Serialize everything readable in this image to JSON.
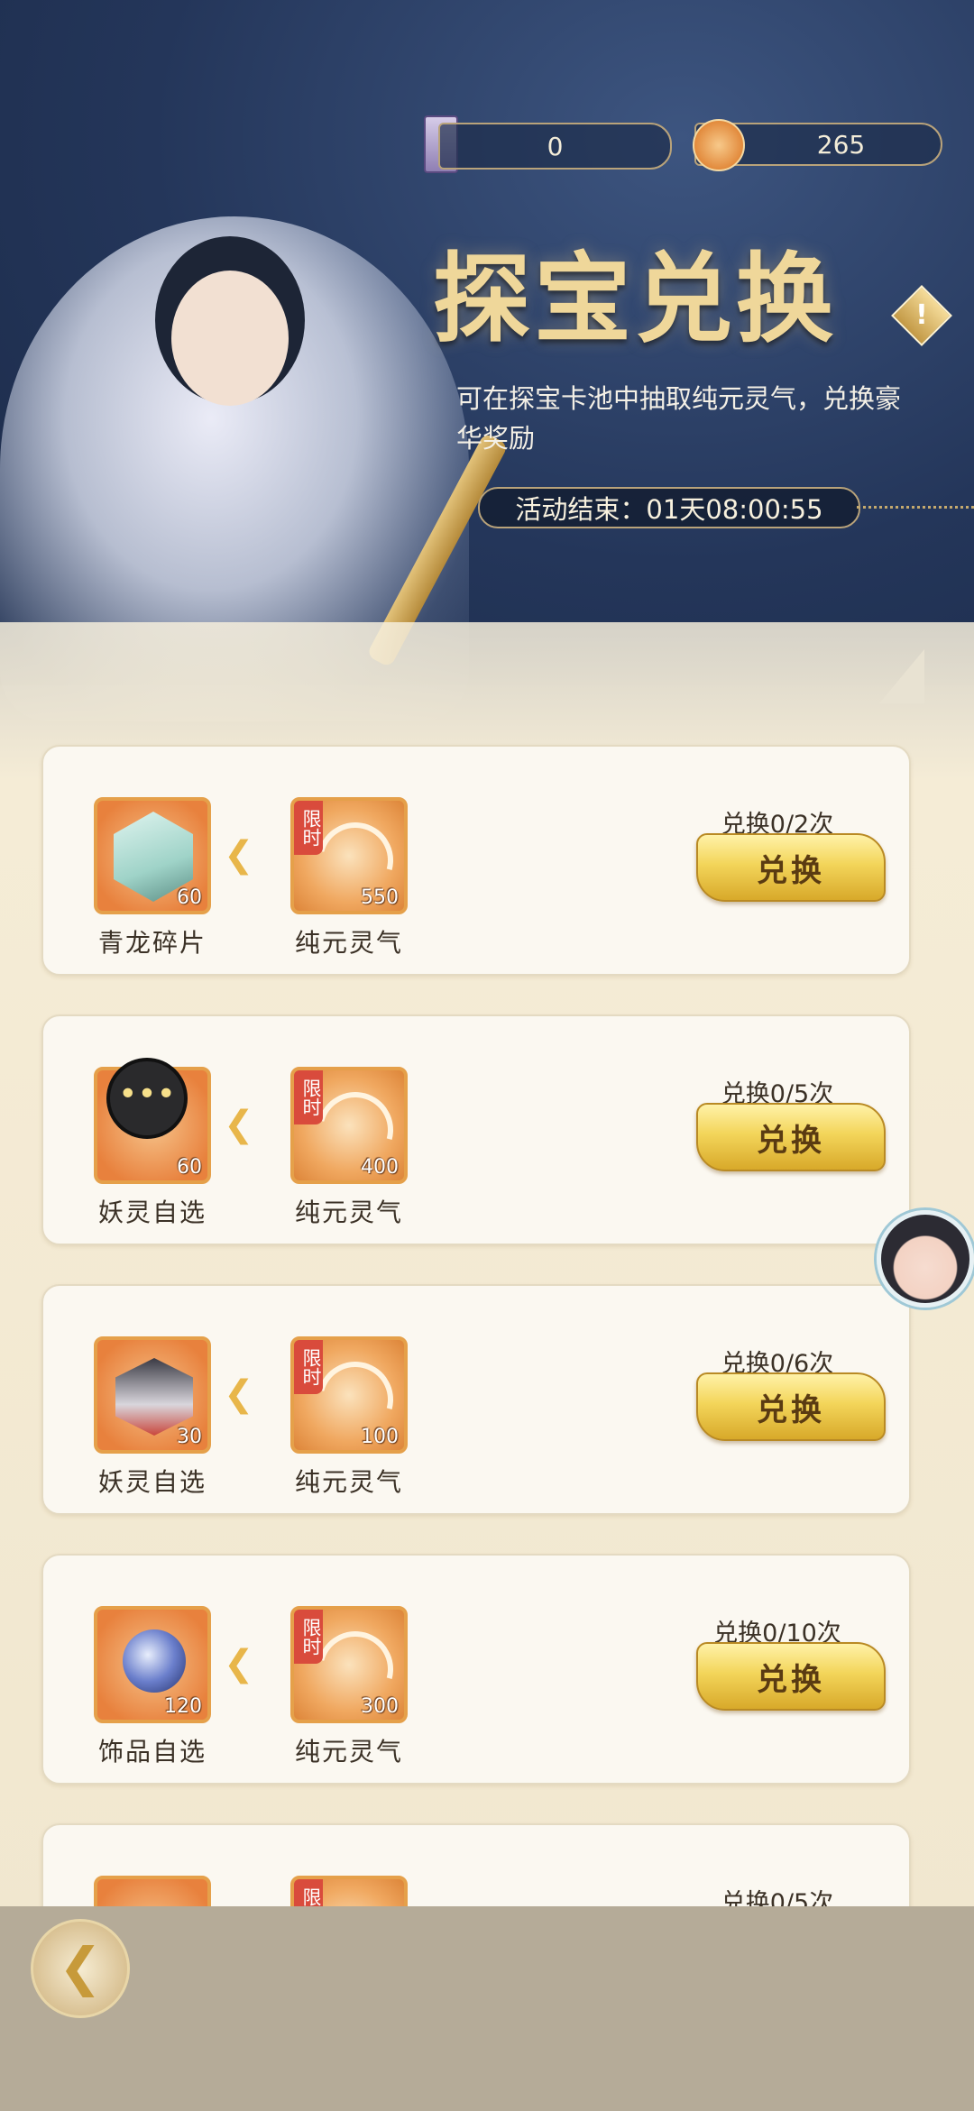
{
  "currency": {
    "tickets": "0",
    "coins": "265"
  },
  "header": {
    "title": "探宝兑换",
    "info_icon": "!",
    "description": "可在探宝卡池中抽取纯元灵气，兑换豪华奖励",
    "timer_label": "活动结束：",
    "timer_value": "01天08:00:55"
  },
  "exchange": {
    "limited_tag": "限时",
    "button_label": "兑换",
    "items": [
      {
        "reward_name": "青龙碎片",
        "reward_count": "60",
        "cost_name": "纯元灵气",
        "cost_count": "550",
        "limit": "兑换0/2次"
      },
      {
        "reward_name": "妖灵自选",
        "reward_count": "60",
        "cost_name": "纯元灵气",
        "cost_count": "400",
        "limit": "兑换0/5次"
      },
      {
        "reward_name": "妖灵自选",
        "reward_count": "30",
        "cost_name": "纯元灵气",
        "cost_count": "100",
        "limit": "兑换0/6次"
      },
      {
        "reward_name": "饰品自选",
        "reward_count": "120",
        "cost_name": "纯元灵气",
        "cost_count": "300",
        "limit": "兑换0/10次"
      },
      {
        "limit": "兑换0/5次"
      }
    ]
  },
  "icons": {
    "arrow": "arrow-left-icon",
    "back": "back-icon",
    "chat": "chat-bubble-icon"
  },
  "colors": {
    "button_gold": "#f3d55a",
    "limited_red": "#d94b3c",
    "title_gold": "#efd79a"
  }
}
